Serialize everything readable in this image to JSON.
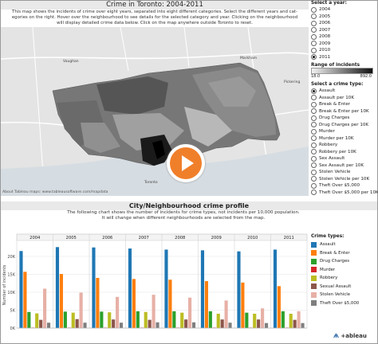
{
  "header": {
    "title": "Crime in Toronto: 2004-2011",
    "intro_lines": [
      "This map shows the incidents of crime over eight years, separated into eight different categories. Select the different years and cat-",
      "egories on the right. Hover over the neighbourhood to see details for the selected category and year. Clicking on the neighbourhood",
      "will display detailed crime data below. Click on the map anywhere outside Toronto to reset."
    ]
  },
  "map": {
    "attribution": "About Tableau maps: www.tableausoftware.com/mapdata",
    "place_labels": [
      "Vaughan",
      "Markham",
      "Pickering",
      "Toronto"
    ]
  },
  "year_filter": {
    "label": "Select a year:",
    "options": [
      "2004",
      "2005",
      "2006",
      "2007",
      "2008",
      "2009",
      "2010",
      "2011"
    ],
    "selected": "2011"
  },
  "range_legend": {
    "label": "Range of incidents",
    "min": "18.0",
    "max": "892.0"
  },
  "crime_filter": {
    "label": "Select a crime type:",
    "options": [
      "Assault",
      "Assault per 10K",
      "Break & Enter",
      "Break & Enter per 10K",
      "Drug Charges",
      "Drug Charges per 10K",
      "Murder",
      "Murder per 10K",
      "Robbery",
      "Robbery per 10K",
      "Sex Assault",
      "Sex Assault per 10K",
      "Stolen Vehicle",
      "Stolen Vehicle per 10K",
      "Theft Over $5,000",
      "Theft Over $5,000 per 10K"
    ],
    "selected": "Assault"
  },
  "profile": {
    "title": "City/Neighbourhood crime profile",
    "desc_lines": [
      "The following chart shows the number of incidents for crime types, not incidents per 10,000 population.",
      "It will change when different neighbourhoods are selected from the map."
    ]
  },
  "crime_types_legend": {
    "label": "Crime types:",
    "items": [
      {
        "name": "Assault",
        "color": "#1f77b4"
      },
      {
        "name": "Break & Enter",
        "color": "#ff7f0e"
      },
      {
        "name": "Drug Charges",
        "color": "#2ca02c"
      },
      {
        "name": "Murder",
        "color": "#d62728"
      },
      {
        "name": "Robbery",
        "color": "#bcbd22"
      },
      {
        "name": "Sexual Assault",
        "color": "#8c564b"
      },
      {
        "name": "Stolen Vehicle",
        "color": "#e7b0a6"
      },
      {
        "name": "Theft Over $5,000",
        "color": "#7f7f7f"
      }
    ]
  },
  "chart_data": {
    "type": "bar",
    "categories": [
      "2004",
      "2005",
      "2006",
      "2007",
      "2008",
      "2009",
      "2010",
      "2011"
    ],
    "ylabel": "Number of incidents",
    "ylim": [
      0,
      24000
    ],
    "yticks": [
      0,
      5000,
      10000,
      15000,
      20000
    ],
    "ytick_labels": [
      "0K",
      "5K",
      "10K",
      "15K",
      "20K"
    ],
    "series": [
      {
        "name": "Assault",
        "values": [
          21500,
          22600,
          22500,
          22200,
          21900,
          21700,
          21400,
          21900
        ]
      },
      {
        "name": "Break & Enter",
        "values": [
          15700,
          15100,
          14000,
          13700,
          13500,
          13100,
          12700,
          11700
        ]
      },
      {
        "name": "Drug Charges",
        "values": [
          4500,
          4600,
          4600,
          4700,
          4700,
          4700,
          4300,
          4700
        ]
      },
      {
        "name": "Murder",
        "values": [
          130,
          130,
          130,
          130,
          130,
          130,
          130,
          130
        ]
      },
      {
        "name": "Robbery",
        "values": [
          4100,
          4300,
          4400,
          4500,
          4300,
          4000,
          4000,
          4000
        ]
      },
      {
        "name": "Sexual Assault",
        "values": [
          2300,
          2500,
          2400,
          2300,
          2400,
          2400,
          2400,
          2300
        ]
      },
      {
        "name": "Stolen Vehicle",
        "values": [
          11000,
          9900,
          8700,
          9300,
          8500,
          7700,
          5500,
          4700
        ]
      },
      {
        "name": "Theft Over $5,000",
        "values": [
          1500,
          1500,
          1500,
          1600,
          1600,
          1500,
          1400,
          1400
        ]
      }
    ]
  },
  "branding": {
    "logo_text": "+ableau",
    "logo_prefix": "Ѧ "
  }
}
